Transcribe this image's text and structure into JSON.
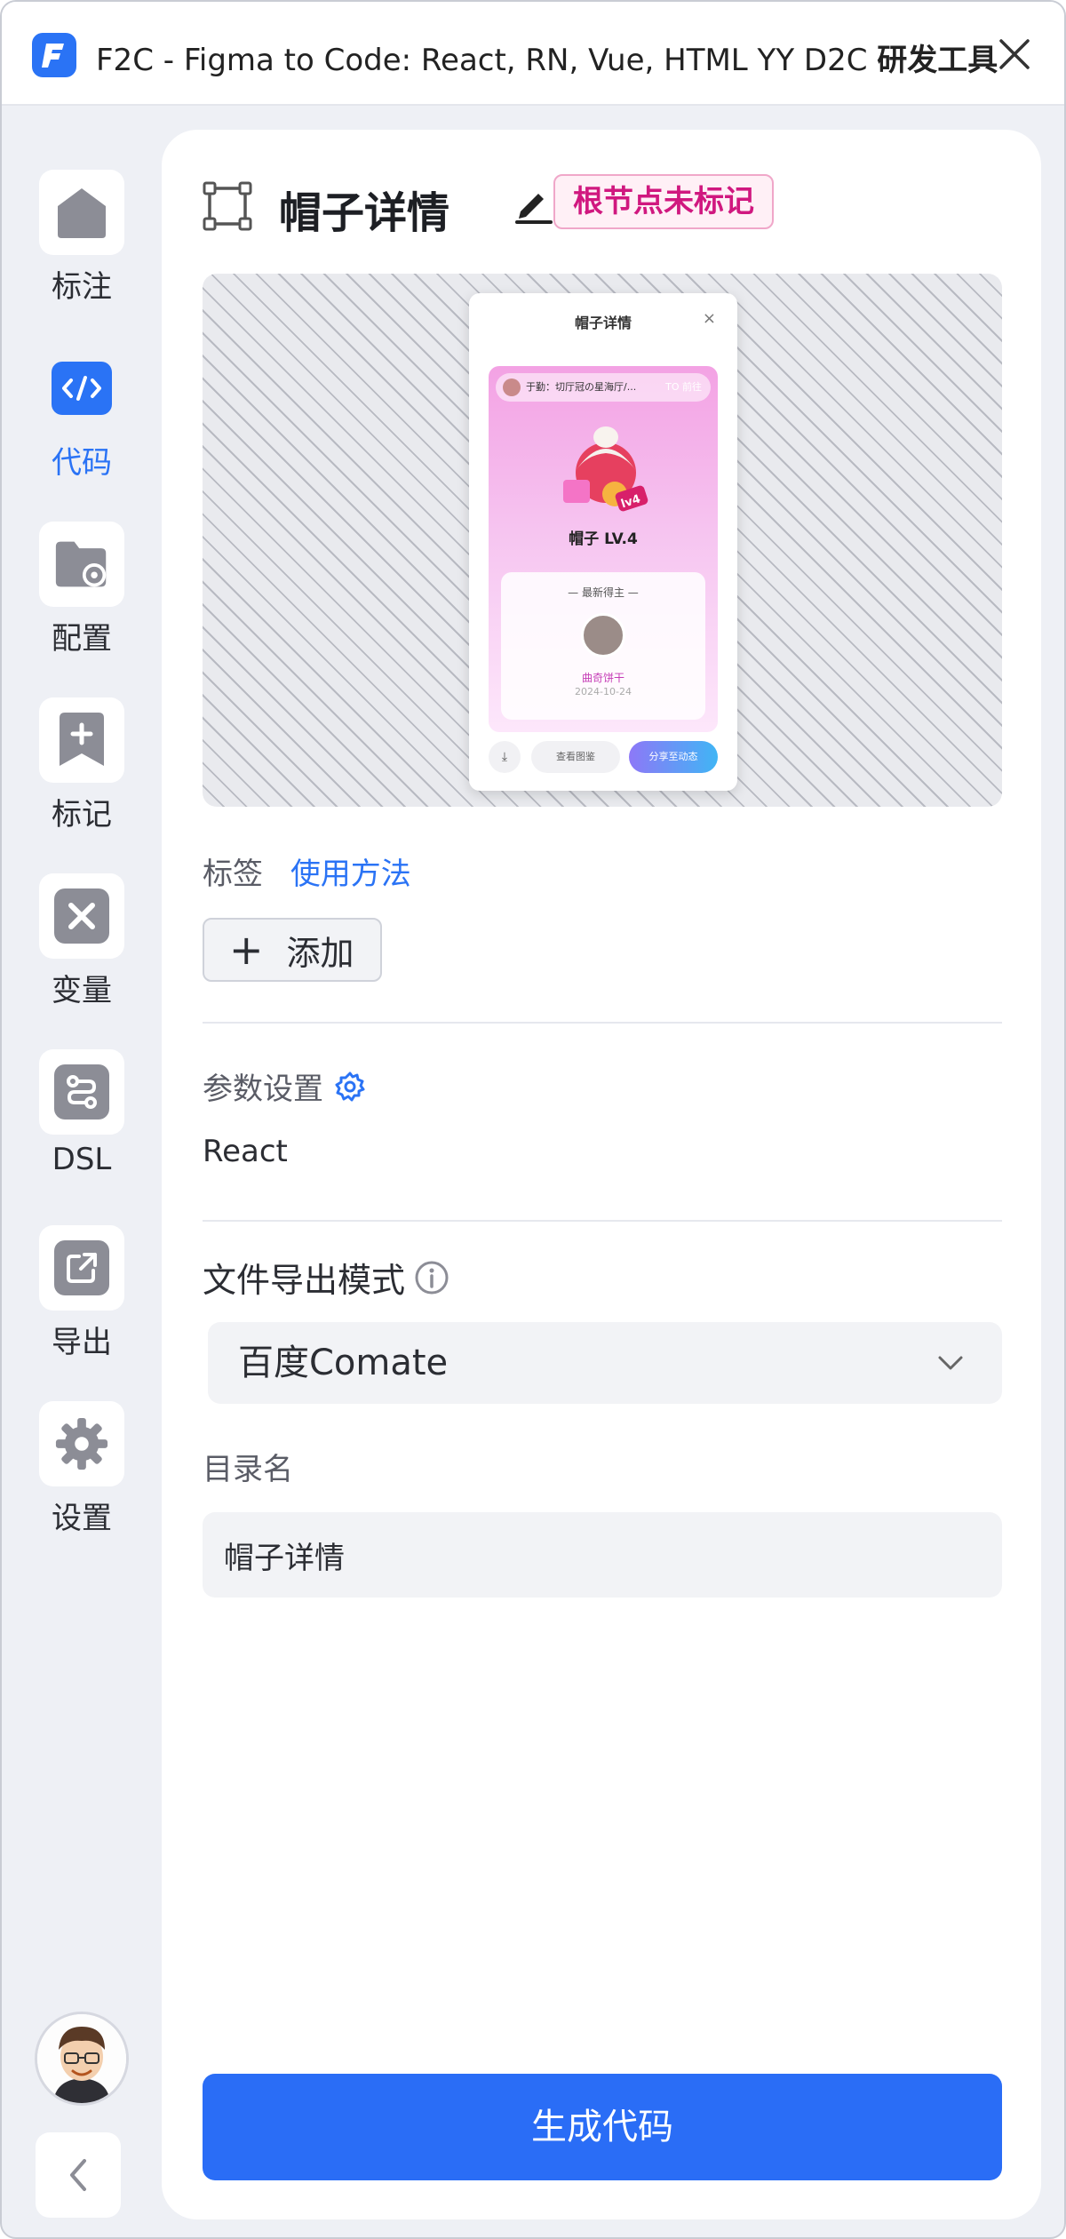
{
  "window": {
    "title_prefix": "F2C - Figma to Code: React, RN, Vue, HTML YY D2C ",
    "title_bold": "研发工具",
    "app_icon": "f2c-logo-icon",
    "close_icon": "close-icon"
  },
  "sidebar": {
    "items": [
      {
        "label": "标注",
        "icon": "home-icon",
        "active": false
      },
      {
        "label": "代码",
        "icon": "code-icon",
        "active": true
      },
      {
        "label": "配置",
        "icon": "folder-settings-icon",
        "active": false
      },
      {
        "label": "标记",
        "icon": "bookmark-add-icon",
        "active": false
      },
      {
        "label": "变量",
        "icon": "variable-icon",
        "active": false
      },
      {
        "label": "DSL",
        "icon": "route-icon",
        "active": false
      },
      {
        "label": "导出",
        "icon": "export-icon",
        "active": false
      },
      {
        "label": "设置",
        "icon": "gear-icon",
        "active": false
      }
    ],
    "collapse_icon": "chevron-left-icon"
  },
  "panel": {
    "node_title": "帽子详情",
    "badge": "根节点未标记",
    "preview": {
      "title": "帽子详情",
      "close": "×",
      "banner_left": "于勤：切厅冠の星海厅/...",
      "banner_right": "TO 前往",
      "name": "帽子 LV.4",
      "winner_title": "— 最新得主 —",
      "winner_name": "曲奇饼干",
      "winner_date": "2024-10-24",
      "view_btn": "查看图鉴",
      "share_btn": "分享至动态"
    },
    "tags_label": "标签",
    "usage_link": "使用方法",
    "add_button": "添加",
    "params_label": "参数设置",
    "framework": "React",
    "export_mode_label": "文件导出模式",
    "export_mode_value": "百度Comate",
    "dir_label": "目录名",
    "dir_value": "帽子详情",
    "generate_button": "生成代码"
  },
  "colors": {
    "accent": "#2a73f5",
    "badge_text": "#d0187f",
    "badge_bg": "#fff0f6",
    "sidebar_bg": "#eef0f5"
  }
}
